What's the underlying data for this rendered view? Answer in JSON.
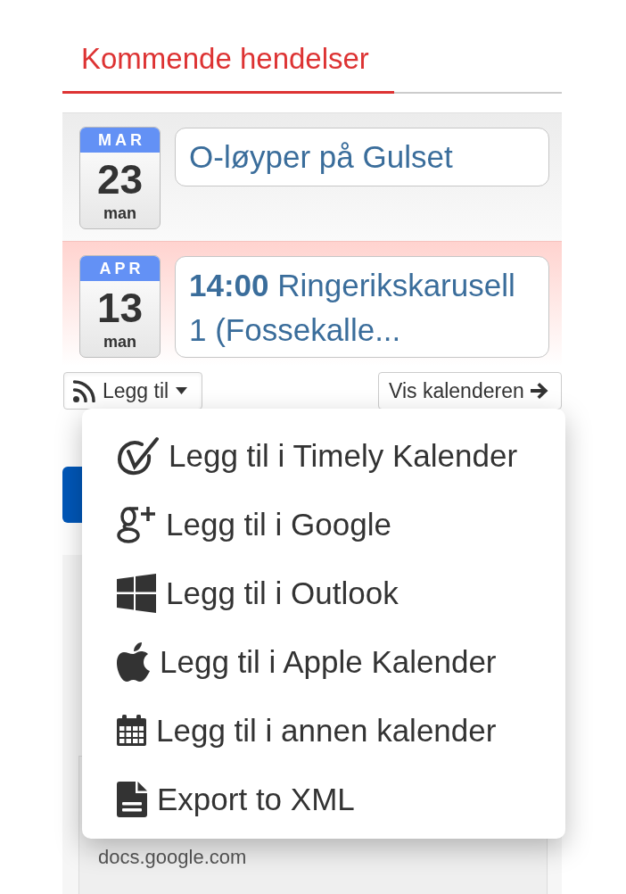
{
  "section": {
    "title": "Kommende hendelser"
  },
  "events": [
    {
      "month": "MAR",
      "day": "23",
      "weekday": "man",
      "title": "O-løyper på Gulset",
      "highlighted": false
    },
    {
      "month": "APR",
      "day": "13",
      "weekday": "man",
      "title": "**14:00** Ringerikskarusell 1 (Fossekalle...",
      "highlighted": true
    }
  ],
  "toolbar": {
    "add_button": {
      "label": "Legg til",
      "expanded": true
    },
    "calendar_button": {
      "label": "Vis kalenderen"
    }
  },
  "add_menu": {
    "items": [
      {
        "kind": "timely",
        "label": "Legg til i Timely Kalender"
      },
      {
        "kind": "google",
        "label": "Legg til i Google"
      },
      {
        "kind": "outlook",
        "label": "Legg til i Outlook"
      },
      {
        "kind": "apple",
        "label": "Legg til i Apple Kalender"
      },
      {
        "kind": "calendar",
        "label": "Legg til i annen kalender"
      },
      {
        "kind": "document",
        "label": "Export to XML"
      }
    ]
  },
  "background_card": {
    "url": "docs.google.com"
  }
}
